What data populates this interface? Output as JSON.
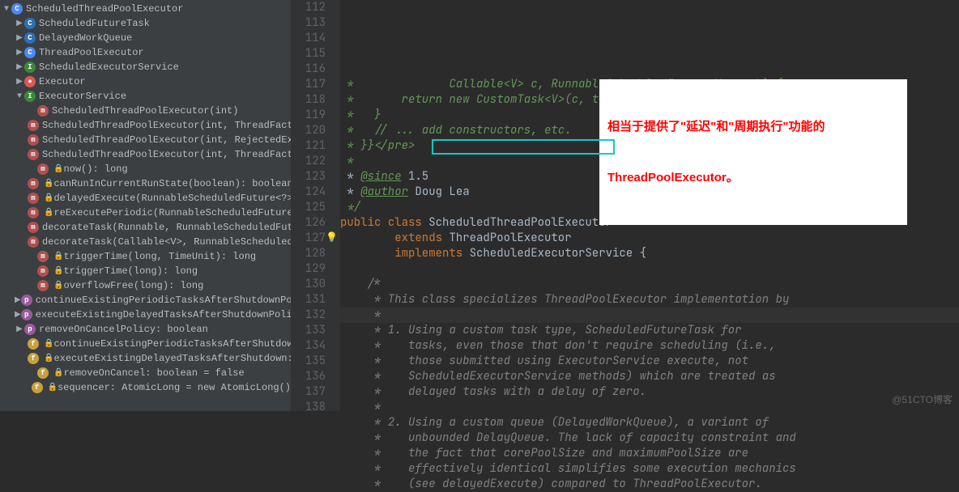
{
  "tree": [
    {
      "lvl": 0,
      "arrow": "▼",
      "icon": "i-class",
      "il": "C",
      "label": "ScheduledThreadPoolExecutor"
    },
    {
      "lvl": 1,
      "arrow": "▶",
      "icon": "i-class2",
      "il": "C",
      "label": "ScheduledFutureTask"
    },
    {
      "lvl": 1,
      "arrow": "▶",
      "icon": "i-class2",
      "il": "C",
      "label": "DelayedWorkQueue"
    },
    {
      "lvl": 1,
      "arrow": "▶",
      "icon": "i-class",
      "il": "C",
      "label": "ThreadPoolExecutor"
    },
    {
      "lvl": 1,
      "arrow": "▶",
      "icon": "i-iface",
      "il": "I",
      "label": "ScheduledExecutorService"
    },
    {
      "lvl": 1,
      "arrow": "▶",
      "icon": "i-stop",
      "il": "●",
      "label": "Executor"
    },
    {
      "lvl": 1,
      "arrow": "▼",
      "icon": "i-iface",
      "il": "I",
      "label": "ExecutorService"
    },
    {
      "lvl": 2,
      "arrow": "",
      "icon": "i-m",
      "il": "m",
      "label": "ScheduledThreadPoolExecutor(int)"
    },
    {
      "lvl": 2,
      "arrow": "",
      "icon": "i-m",
      "il": "m",
      "label": "ScheduledThreadPoolExecutor(int, ThreadFactory)"
    },
    {
      "lvl": 2,
      "arrow": "",
      "icon": "i-m",
      "il": "m",
      "label": "ScheduledThreadPoolExecutor(int, RejectedExecutionHandler)"
    },
    {
      "lvl": 2,
      "arrow": "",
      "icon": "i-m",
      "il": "m",
      "label": "ScheduledThreadPoolExecutor(int, ThreadFactory, RejectedExecutionHandler)"
    },
    {
      "lvl": 2,
      "arrow": "",
      "icon": "i-m",
      "il": "m",
      "label": "now(): long",
      "lock": true
    },
    {
      "lvl": 2,
      "arrow": "",
      "icon": "i-m",
      "il": "m",
      "label": "canRunInCurrentRunState(boolean): boolean",
      "lock": true
    },
    {
      "lvl": 2,
      "arrow": "",
      "icon": "i-m",
      "il": "m",
      "label": "delayedExecute(RunnableScheduledFuture<?>): void",
      "lock": true
    },
    {
      "lvl": 2,
      "arrow": "",
      "icon": "i-m",
      "il": "m",
      "label": "reExecutePeriodic(RunnableScheduledFuture<?>): void",
      "lock": true
    },
    {
      "lvl": 2,
      "arrow": "",
      "icon": "i-m",
      "il": "m",
      "label": "decorateTask(Runnable, RunnableScheduledFuture<V>)"
    },
    {
      "lvl": 2,
      "arrow": "",
      "icon": "i-m",
      "il": "m",
      "label": "decorateTask(Callable<V>, RunnableScheduledFuture<V>)"
    },
    {
      "lvl": 2,
      "arrow": "",
      "icon": "i-m",
      "il": "m",
      "label": "triggerTime(long, TimeUnit): long",
      "lock": true
    },
    {
      "lvl": 2,
      "arrow": "",
      "icon": "i-m",
      "il": "m",
      "label": "triggerTime(long): long",
      "lock": true
    },
    {
      "lvl": 2,
      "arrow": "",
      "icon": "i-m",
      "il": "m",
      "label": "overflowFree(long): long",
      "lock": true
    },
    {
      "lvl": 1,
      "arrow": "▶",
      "icon": "i-p",
      "il": "p",
      "label": "continueExistingPeriodicTasksAfterShutdownPolicy: boolean"
    },
    {
      "lvl": 1,
      "arrow": "▶",
      "icon": "i-p",
      "il": "p",
      "label": "executeExistingDelayedTasksAfterShutdownPolicy: boolean"
    },
    {
      "lvl": 1,
      "arrow": "▶",
      "icon": "i-p",
      "il": "p",
      "label": "removeOnCancelPolicy: boolean"
    },
    {
      "lvl": 2,
      "arrow": "",
      "icon": "i-f",
      "il": "f",
      "label": "continueExistingPeriodicTasksAfterShutdown: boolean",
      "lock": true
    },
    {
      "lvl": 2,
      "arrow": "",
      "icon": "i-f",
      "il": "f",
      "label": "executeExistingDelayedTasksAfterShutdown: boolean",
      "lock": true
    },
    {
      "lvl": 2,
      "arrow": "",
      "icon": "i-f",
      "il": "f",
      "label": "removeOnCancel: boolean = false",
      "lock": true
    },
    {
      "lvl": 2,
      "arrow": "",
      "icon": "i-f",
      "il": "f",
      "label": "sequencer: AtomicLong = new AtomicLong()",
      "lock": true
    }
  ],
  "lines": [
    {
      "n": 112,
      "cls": "c-doc",
      "t": " *              Callable<V> c, RunnableScheduledFuture<V> task) {"
    },
    {
      "n": 113,
      "cls": "c-doc",
      "t": " *       return new CustomTask<V>(c, task);"
    },
    {
      "n": 114,
      "cls": "c-doc",
      "t": " *   }"
    },
    {
      "n": 115,
      "cls": "c-doc",
      "t": " *   // ... add constructors, etc."
    },
    {
      "n": 116,
      "cls": "c-doc",
      "t": " * }}</pre>"
    },
    {
      "n": 117,
      "cls": "c-doc",
      "t": " *"
    },
    {
      "n": 118,
      "cls": "c-doc",
      "html": " * <span class='c-tag'>@since</span> 1.5"
    },
    {
      "n": 119,
      "cls": "c-doc",
      "html": " * <span class='c-tag'>@author</span> Doug Lea"
    },
    {
      "n": 120,
      "cls": "c-doc",
      "t": " */"
    },
    {
      "n": 121,
      "html": "<span class='c-kw'>public class </span><span class='c-type'>ScheduledThreadPoolExecutor</span>"
    },
    {
      "n": 122,
      "html": "        <span class='c-kw'>extends </span><span class='c-type'>ThreadPoolExecutor</span>"
    },
    {
      "n": 123,
      "html": "        <span class='c-kw'>implements </span><span class='c-type'>ScheduledExecutorService {</span>"
    },
    {
      "n": 124,
      "t": ""
    },
    {
      "n": 125,
      "cls": "c-comment",
      "t": "    /*"
    },
    {
      "n": 126,
      "cls": "c-comment",
      "t": "     * This class specializes ThreadPoolExecutor implementation by"
    },
    {
      "n": 127,
      "cls": "c-comment",
      "t": "     *",
      "cur": true
    },
    {
      "n": 128,
      "cls": "c-comment",
      "t": "     * 1. Using a custom task type, ScheduledFutureTask for"
    },
    {
      "n": 129,
      "cls": "c-comment",
      "t": "     *    tasks, even those that don't require scheduling (i.e.,"
    },
    {
      "n": 130,
      "cls": "c-comment",
      "t": "     *    those submitted using ExecutorService execute, not"
    },
    {
      "n": 131,
      "cls": "c-comment",
      "t": "     *    ScheduledExecutorService methods) which are treated as"
    },
    {
      "n": 132,
      "cls": "c-comment",
      "t": "     *    delayed tasks with a delay of zero."
    },
    {
      "n": 133,
      "cls": "c-comment",
      "t": "     *"
    },
    {
      "n": 134,
      "cls": "c-comment",
      "t": "     * 2. Using a custom queue (DelayedWorkQueue), a variant of"
    },
    {
      "n": 135,
      "cls": "c-comment",
      "t": "     *    unbounded DelayQueue. The lack of capacity constraint and"
    },
    {
      "n": 136,
      "cls": "c-comment",
      "t": "     *    the fact that corePoolSize and maximumPoolSize are"
    },
    {
      "n": 137,
      "cls": "c-comment",
      "t": "     *    effectively identical simplifies some execution mechanics"
    },
    {
      "n": 138,
      "cls": "c-comment",
      "t": "     *    (see delayedExecute) compared to ThreadPoolExecutor."
    }
  ],
  "annotation": {
    "line1": "相当于提供了\"延迟\"和\"周期执行\"功能的",
    "line2": "ThreadPoolExecutor。"
  },
  "watermark": "@51CTO博客"
}
